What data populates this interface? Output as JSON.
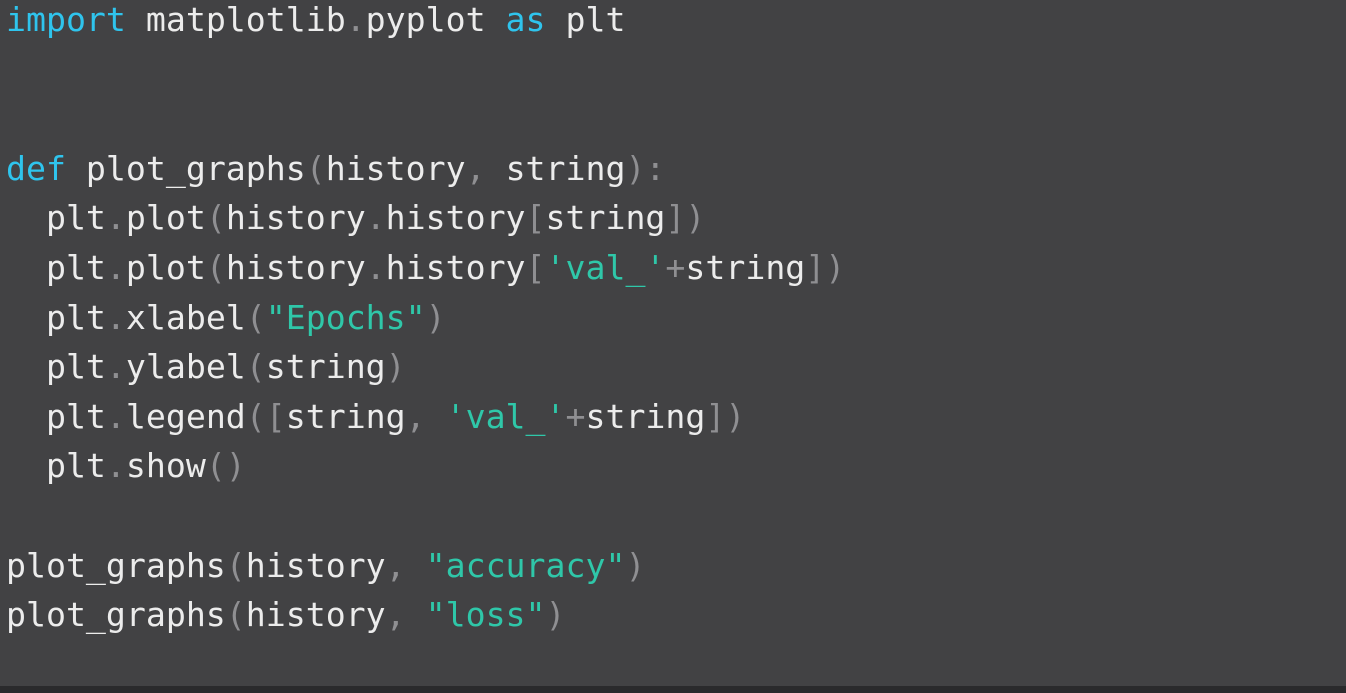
{
  "code": {
    "language": "python",
    "colors": {
      "background": "#424244",
      "keyword": "#2fc4ed",
      "string": "#2fc7a9",
      "punctuation": "#8f8f92",
      "text": "#ececec"
    },
    "lines": [
      [
        {
          "t": "kw",
          "v": "import"
        },
        {
          "t": "id",
          "v": " matplotlib"
        },
        {
          "t": "punc",
          "v": "."
        },
        {
          "t": "id",
          "v": "pyplot "
        },
        {
          "t": "kw",
          "v": "as"
        },
        {
          "t": "id",
          "v": " plt"
        }
      ],
      [],
      [],
      [
        {
          "t": "kw",
          "v": "def"
        },
        {
          "t": "id",
          "v": " plot_graphs"
        },
        {
          "t": "punc",
          "v": "("
        },
        {
          "t": "id",
          "v": "history"
        },
        {
          "t": "punc",
          "v": ", "
        },
        {
          "t": "id",
          "v": "string"
        },
        {
          "t": "punc",
          "v": "):"
        }
      ],
      [
        {
          "t": "id",
          "v": "  plt"
        },
        {
          "t": "punc",
          "v": "."
        },
        {
          "t": "id",
          "v": "plot"
        },
        {
          "t": "punc",
          "v": "("
        },
        {
          "t": "id",
          "v": "history"
        },
        {
          "t": "punc",
          "v": "."
        },
        {
          "t": "id",
          "v": "history"
        },
        {
          "t": "punc",
          "v": "["
        },
        {
          "t": "id",
          "v": "string"
        },
        {
          "t": "punc",
          "v": "])"
        }
      ],
      [
        {
          "t": "id",
          "v": "  plt"
        },
        {
          "t": "punc",
          "v": "."
        },
        {
          "t": "id",
          "v": "plot"
        },
        {
          "t": "punc",
          "v": "("
        },
        {
          "t": "id",
          "v": "history"
        },
        {
          "t": "punc",
          "v": "."
        },
        {
          "t": "id",
          "v": "history"
        },
        {
          "t": "punc",
          "v": "["
        },
        {
          "t": "str",
          "v": "'val_'"
        },
        {
          "t": "punc",
          "v": "+"
        },
        {
          "t": "id",
          "v": "string"
        },
        {
          "t": "punc",
          "v": "])"
        }
      ],
      [
        {
          "t": "id",
          "v": "  plt"
        },
        {
          "t": "punc",
          "v": "."
        },
        {
          "t": "id",
          "v": "xlabel"
        },
        {
          "t": "punc",
          "v": "("
        },
        {
          "t": "str",
          "v": "\"Epochs\""
        },
        {
          "t": "punc",
          "v": ")"
        }
      ],
      [
        {
          "t": "id",
          "v": "  plt"
        },
        {
          "t": "punc",
          "v": "."
        },
        {
          "t": "id",
          "v": "ylabel"
        },
        {
          "t": "punc",
          "v": "("
        },
        {
          "t": "id",
          "v": "string"
        },
        {
          "t": "punc",
          "v": ")"
        }
      ],
      [
        {
          "t": "id",
          "v": "  plt"
        },
        {
          "t": "punc",
          "v": "."
        },
        {
          "t": "id",
          "v": "legend"
        },
        {
          "t": "punc",
          "v": "(["
        },
        {
          "t": "id",
          "v": "string"
        },
        {
          "t": "punc",
          "v": ", "
        },
        {
          "t": "str",
          "v": "'val_'"
        },
        {
          "t": "punc",
          "v": "+"
        },
        {
          "t": "id",
          "v": "string"
        },
        {
          "t": "punc",
          "v": "])"
        }
      ],
      [
        {
          "t": "id",
          "v": "  plt"
        },
        {
          "t": "punc",
          "v": "."
        },
        {
          "t": "id",
          "v": "show"
        },
        {
          "t": "punc",
          "v": "()"
        }
      ],
      [],
      [
        {
          "t": "id",
          "v": "plot_graphs"
        },
        {
          "t": "punc",
          "v": "("
        },
        {
          "t": "id",
          "v": "history"
        },
        {
          "t": "punc",
          "v": ", "
        },
        {
          "t": "str",
          "v": "\"accuracy\""
        },
        {
          "t": "punc",
          "v": ")"
        }
      ],
      [
        {
          "t": "id",
          "v": "plot_graphs"
        },
        {
          "t": "punc",
          "v": "("
        },
        {
          "t": "id",
          "v": "history"
        },
        {
          "t": "punc",
          "v": ", "
        },
        {
          "t": "str",
          "v": "\"loss\""
        },
        {
          "t": "punc",
          "v": ")"
        }
      ]
    ]
  }
}
